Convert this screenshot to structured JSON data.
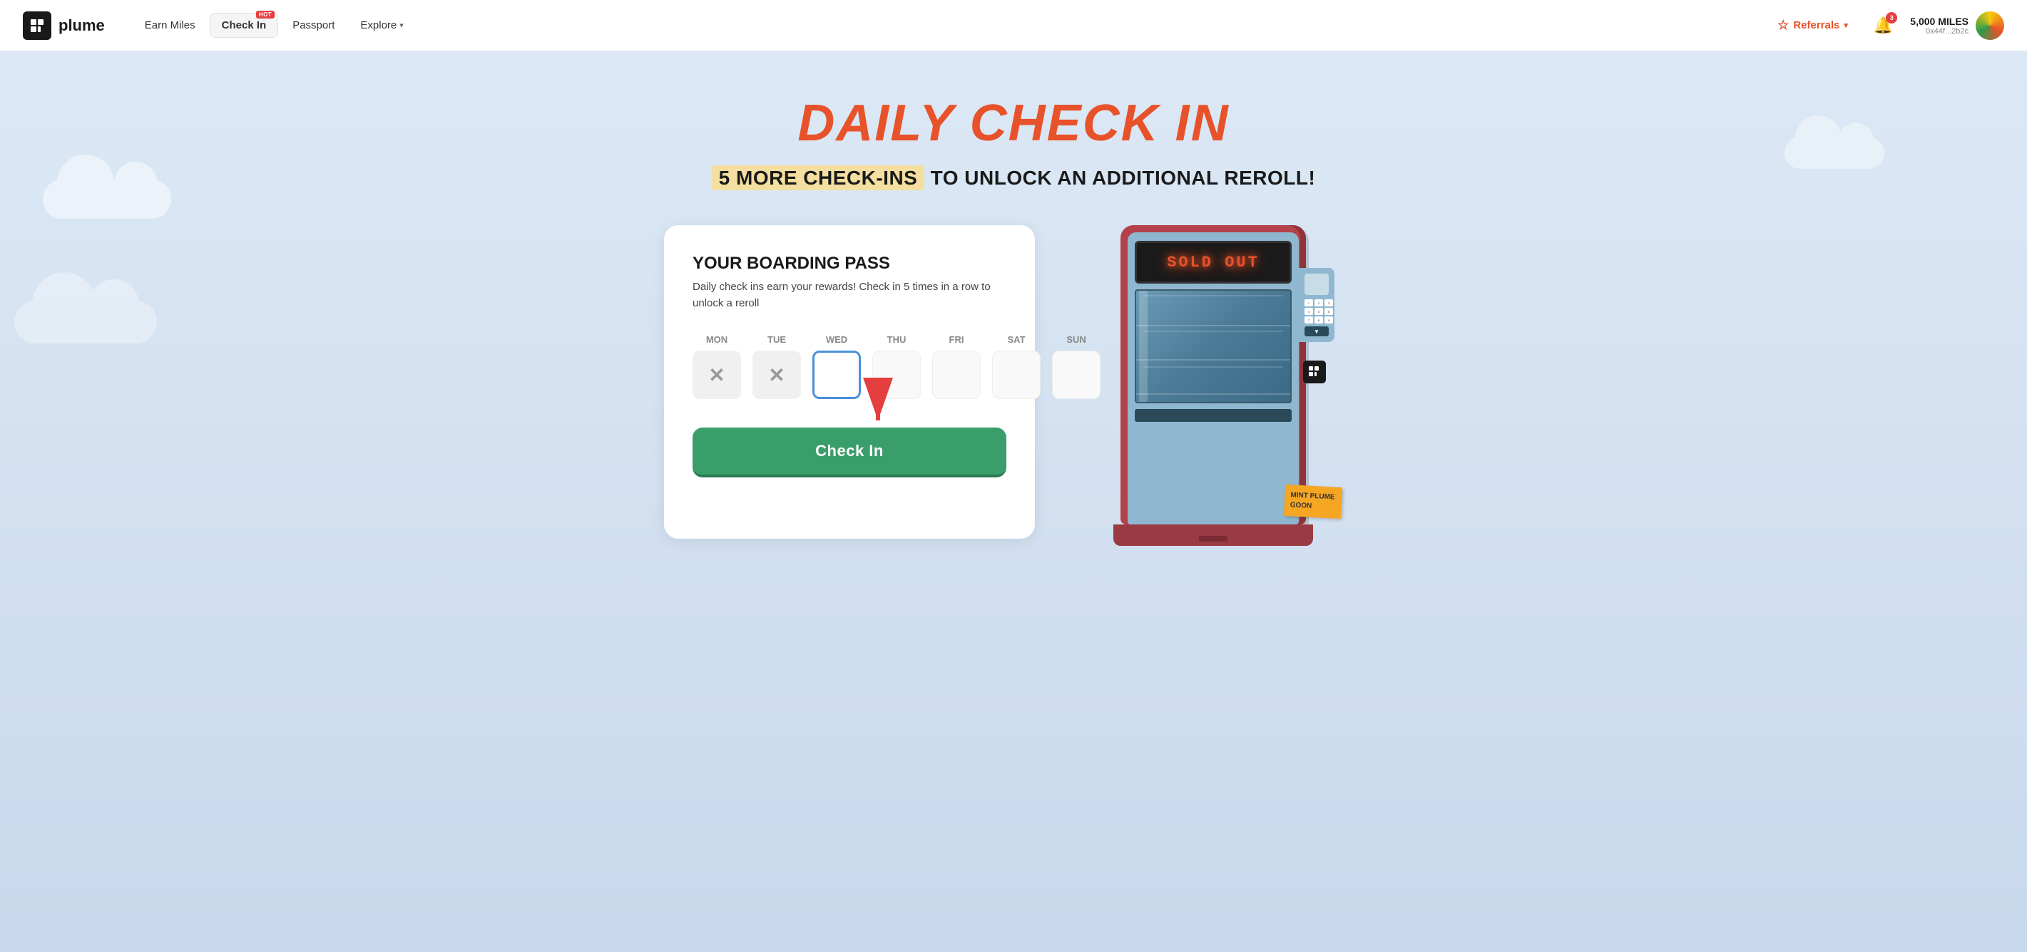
{
  "navbar": {
    "logo_text": "plume",
    "nav_links": [
      {
        "label": "Earn Miles",
        "id": "earn-miles",
        "active": false,
        "hot": false
      },
      {
        "label": "Check In",
        "id": "check-in",
        "active": true,
        "hot": true
      },
      {
        "label": "Passport",
        "id": "passport",
        "active": false,
        "hot": false
      },
      {
        "label": "Explore",
        "id": "explore",
        "active": false,
        "hot": false,
        "has_dropdown": true
      }
    ],
    "referrals_label": "Referrals",
    "notification_count": "3",
    "miles_amount": "5,000 MILES",
    "wallet_address": "0x44f...2b2c"
  },
  "hero": {
    "title": "DAILY CHECK IN",
    "subtitle_highlight": "5 MORE CHECK-INS",
    "subtitle_rest": " TO UNLOCK AN ADDITIONAL REROLL!"
  },
  "boarding_pass": {
    "title": "YOUR BOARDING PASS",
    "description": "Daily check ins earn your rewards! Check in 5 times in a row to unlock a reroll",
    "days": [
      {
        "label": "MON",
        "state": "checked",
        "symbol": "×"
      },
      {
        "label": "TUE",
        "state": "checked",
        "symbol": "×"
      },
      {
        "label": "WED",
        "state": "today",
        "symbol": ""
      },
      {
        "label": "THU",
        "state": "empty",
        "symbol": ""
      },
      {
        "label": "FRI",
        "state": "empty",
        "symbol": ""
      },
      {
        "label": "SAT",
        "state": "empty",
        "symbol": ""
      },
      {
        "label": "SUN",
        "state": "empty",
        "symbol": ""
      }
    ],
    "checkin_button_label": "Check In"
  },
  "vending_machine": {
    "sold_out_text": "SOLD OUT",
    "note_text": "MINT PLUME GOON",
    "keypad_rows": [
      "123",
      "456",
      "789"
    ]
  }
}
